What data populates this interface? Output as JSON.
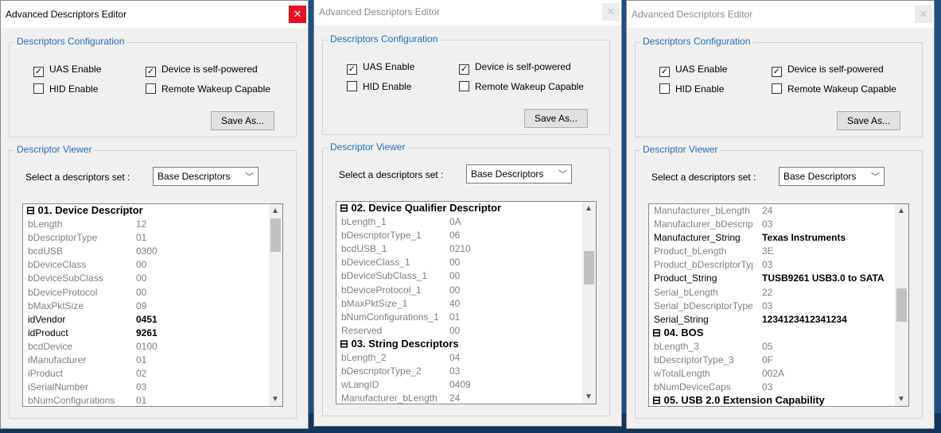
{
  "windows": [
    {
      "title": "Advanced Descriptors Editor",
      "close_glyph": "✕",
      "config_legend": "Descriptors Configuration",
      "uas_enable": "UAS Enable",
      "self_powered": "Device is self-powered",
      "hid_enable": "HID Enable",
      "remote_wakeup": "Remote Wakeup Capable",
      "save_as": "Save As...",
      "viewer_legend": "Descriptor Viewer",
      "select_label": "Select a descriptors set :",
      "select_value": "Base Descriptors",
      "rows": [
        {
          "type": "section",
          "label": "⊟ 01. Device Descriptor"
        },
        {
          "name": "bLength",
          "value": "12"
        },
        {
          "name": "bDescriptorType",
          "value": "01"
        },
        {
          "name": "bcdUSB",
          "value": "0300"
        },
        {
          "name": "bDeviceClass",
          "value": "00"
        },
        {
          "name": "bDeviceSubClass",
          "value": "00"
        },
        {
          "name": "bDeviceProtocol",
          "value": "00"
        },
        {
          "name": "bMaxPktSize",
          "value": "09"
        },
        {
          "name": "idVendor",
          "value": "0451",
          "bold": true
        },
        {
          "name": "idProduct",
          "value": "9261",
          "bold": true
        },
        {
          "name": "bcdDevice",
          "value": "0100"
        },
        {
          "name": "iManufacturer",
          "value": "01"
        },
        {
          "name": "iProduct",
          "value": "02"
        },
        {
          "name": "iSerialNumber",
          "value": "03"
        },
        {
          "name": "bNumConfigurations",
          "value": "01"
        }
      ]
    },
    {
      "title": "Advanced Descriptors Editor",
      "close_glyph": "✕",
      "config_legend": "Descriptors Configuration",
      "uas_enable": "UAS Enable",
      "self_powered": "Device is self-powered",
      "hid_enable": "HID Enable",
      "remote_wakeup": "Remote Wakeup Capable",
      "save_as": "Save As...",
      "viewer_legend": "Descriptor Viewer",
      "select_label": "Select a descriptors set :",
      "select_value": "Base Descriptors",
      "rows": [
        {
          "type": "section",
          "label": "⊟ 02. Device Qualifier Descriptor"
        },
        {
          "name": "bLength_1",
          "value": "0A"
        },
        {
          "name": "bDescriptorType_1",
          "value": "06"
        },
        {
          "name": "bcdUSB_1",
          "value": "0210"
        },
        {
          "name": "bDeviceClass_1",
          "value": "00"
        },
        {
          "name": "bDeviceSubClass_1",
          "value": "00"
        },
        {
          "name": "bDeviceProtocol_1",
          "value": "00"
        },
        {
          "name": "bMaxPktSize_1",
          "value": "40"
        },
        {
          "name": "bNumConfigurations_1",
          "value": "01"
        },
        {
          "name": "Reserved",
          "value": "00"
        },
        {
          "type": "section",
          "label": "⊟ 03. String Descriptors"
        },
        {
          "name": "bLength_2",
          "value": "04"
        },
        {
          "name": "bDescriptorType_2",
          "value": "03"
        },
        {
          "name": "wLangID",
          "value": "0409"
        },
        {
          "name": "Manufacturer_bLength",
          "value": "24"
        }
      ]
    },
    {
      "title": "Advanced Descriptors Editor",
      "close_glyph": "✕",
      "config_legend": "Descriptors Configuration",
      "uas_enable": "UAS Enable",
      "self_powered": "Device is self-powered",
      "hid_enable": "HID Enable",
      "remote_wakeup": "Remote Wakeup Capable",
      "save_as": "Save As...",
      "viewer_legend": "Descriptor Viewer",
      "select_label": "Select a descriptors set :",
      "select_value": "Base Descriptors",
      "rows": [
        {
          "name": "Manufacturer_bLength",
          "value": "24"
        },
        {
          "name": "Manufacturer_bDescriptor",
          "value": "03"
        },
        {
          "name": "Manufacturer_String",
          "value": "Texas Instruments",
          "bold": true
        },
        {
          "name": "Product_bLength",
          "value": "3E"
        },
        {
          "name": "Product_bDescriptorType",
          "value": "03"
        },
        {
          "name": "Product_String",
          "value": "TUSB9261 USB3.0 to SATA",
          "bold": true
        },
        {
          "name": "Serial_bLength",
          "value": "22"
        },
        {
          "name": "Serial_bDescriptorType",
          "value": "03"
        },
        {
          "name": "Serial_String",
          "value": "1234123412341234",
          "bold": true
        },
        {
          "type": "section",
          "label": "⊟ 04. BOS"
        },
        {
          "name": "bLength_3",
          "value": "05"
        },
        {
          "name": "bDescriptorType_3",
          "value": "0F"
        },
        {
          "name": "wTotalLength",
          "value": "002A"
        },
        {
          "name": "bNumDeviceCaps",
          "value": "03"
        },
        {
          "type": "section",
          "label": "⊟ 05. USB 2.0 Extension Capability"
        }
      ]
    }
  ]
}
